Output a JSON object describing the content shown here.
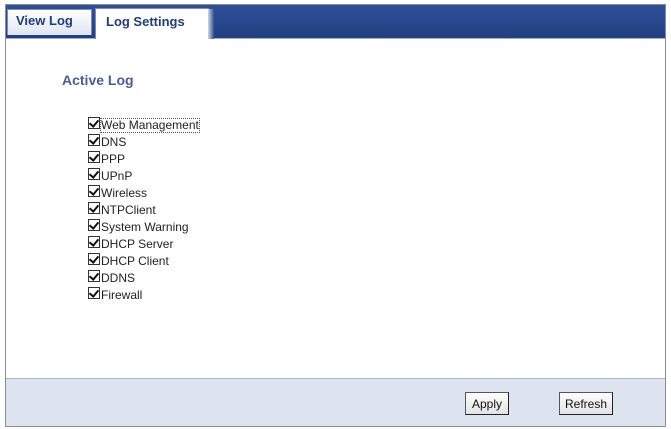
{
  "tabs": [
    {
      "label": "View Log",
      "active": false
    },
    {
      "label": "Log Settings",
      "active": true
    }
  ],
  "section": {
    "title": "Active Log"
  },
  "log_items": [
    {
      "label": "Web Management",
      "checked": true
    },
    {
      "label": "DNS",
      "checked": true
    },
    {
      "label": "PPP",
      "checked": true
    },
    {
      "label": "UPnP",
      "checked": true
    },
    {
      "label": "Wireless",
      "checked": true
    },
    {
      "label": "NTPClient",
      "checked": true
    },
    {
      "label": "System Warning",
      "checked": true
    },
    {
      "label": "DHCP Server",
      "checked": true
    },
    {
      "label": "DHCP Client",
      "checked": true
    },
    {
      "label": "DDNS",
      "checked": true
    },
    {
      "label": "Firewall",
      "checked": true
    }
  ],
  "buttons": {
    "apply": "Apply",
    "refresh": "Refresh"
  },
  "colors": {
    "tabbar": "#2f4f9a",
    "accent_text": "#4a5e96",
    "bottombar": "#dde4ef"
  }
}
